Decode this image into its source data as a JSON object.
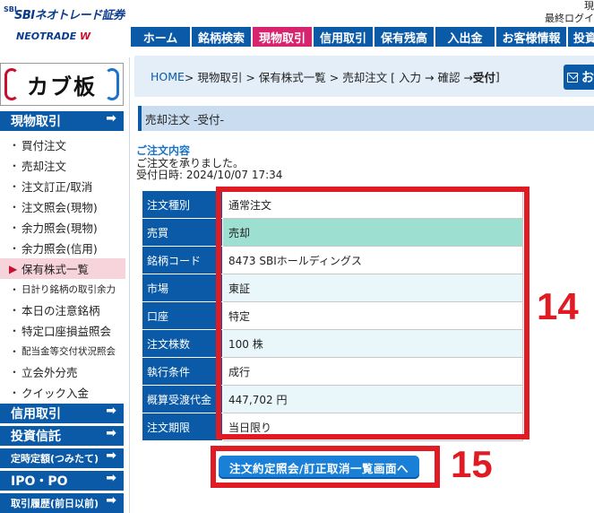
{
  "header": {
    "brand": "SBIネオトレード証券",
    "brand_mark": "SBI",
    "brand_sub": "NEOTRADE",
    "brand_sub_accent": "W",
    "user_line1": "現",
    "user_line2": "最終ログイ"
  },
  "topnav": {
    "tabs": [
      {
        "label": "ホーム",
        "active": false
      },
      {
        "label": "銘柄検索",
        "active": false
      },
      {
        "label": "現物取引",
        "active": true
      },
      {
        "label": "信用取引",
        "active": false
      },
      {
        "label": "保有残高",
        "active": false
      },
      {
        "label": "入出金",
        "active": false
      },
      {
        "label": "お客様情報",
        "active": false
      },
      {
        "label": "投資信",
        "active": false
      }
    ]
  },
  "sidebar": {
    "banner": "カブ板",
    "section_genbutsu": "現物取引",
    "items": [
      {
        "label": "買付注文",
        "small": false,
        "active": false
      },
      {
        "label": "売却注文",
        "small": false,
        "active": false
      },
      {
        "label": "注文訂正/取消",
        "small": false,
        "active": false
      },
      {
        "label": "注文照会(現物)",
        "small": false,
        "active": false
      },
      {
        "label": "余力照会(現物)",
        "small": false,
        "active": false
      },
      {
        "label": "余力照会(信用)",
        "small": false,
        "active": false
      },
      {
        "label": "保有株式一覧",
        "small": false,
        "active": true
      },
      {
        "label": "日計り銘柄の取引余力",
        "small": true,
        "active": false
      },
      {
        "label": "本日の注意銘柄",
        "small": false,
        "active": false
      },
      {
        "label": "特定口座損益照会",
        "small": false,
        "active": false
      },
      {
        "label": "配当金等交付状況照会",
        "small": true,
        "active": false
      },
      {
        "label": "立会外分売",
        "small": false,
        "active": false
      },
      {
        "label": "クイック入金",
        "small": false,
        "active": false
      }
    ],
    "section_shinyo": "信用取引",
    "section_toushin": "投資信託",
    "section_tsumitate": "定時定額(つみたて)",
    "section_ipo": "IPO・PO",
    "section_history": "取引履歴(前日以前)",
    "arrow": "➡"
  },
  "main": {
    "breadcrumb": {
      "home": "HOME",
      "rest": " > 現物取引 > 保有株式一覧 > 売却注文 [ 入力 → 確認 → ",
      "current": "受付",
      "end": " ]"
    },
    "mail_label": "お",
    "section_title": "売却注文 -受付-",
    "order_heading": "ご注文内容",
    "order_message": "ご注文を承りました。",
    "order_datetime": "受付日時: 2024/10/07 17:34",
    "order_rows": [
      {
        "label": "注文種別",
        "value": "通常注文"
      },
      {
        "label": "売買",
        "value": "売却"
      },
      {
        "label": "銘柄コード",
        "value": "8473  SBIホールディングス"
      },
      {
        "label": "市場",
        "value": "東証"
      },
      {
        "label": "口座",
        "value": "特定"
      },
      {
        "label": "注文株数",
        "value": "100 株"
      },
      {
        "label": "執行条件",
        "value": "成行"
      },
      {
        "label": "概算受渡代金",
        "value": "447,702 円"
      },
      {
        "label": "注文期限",
        "value": "当日限り"
      }
    ],
    "action_button": "注文約定照会/訂正取消一覧画面へ",
    "annotation_14": "14",
    "annotation_15": "15",
    "accent_color": "#e01b24",
    "nav_color": "#0b5aa8",
    "active_tab_color": "#d6246e"
  }
}
